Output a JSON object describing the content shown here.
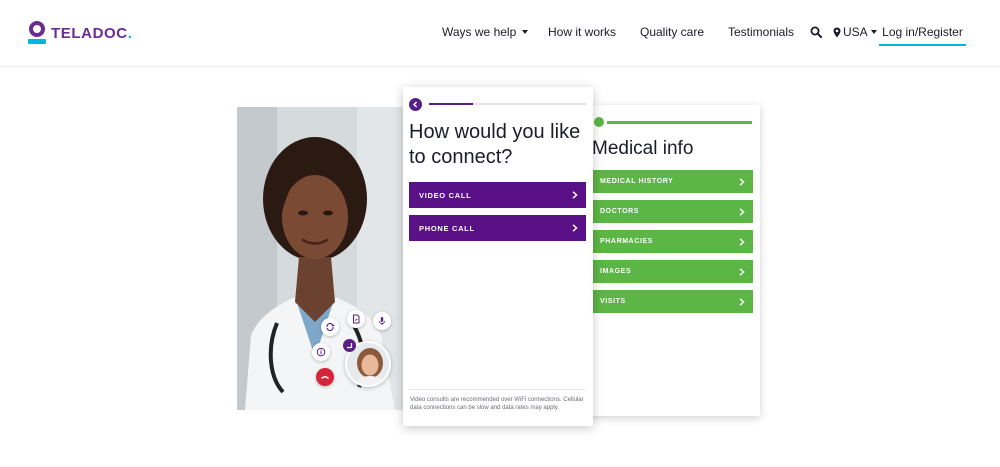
{
  "brand": {
    "name": "TELADOC",
    "dot": ".",
    "colors": {
      "purple": "#6a2c91",
      "cyan": "#00b5e2",
      "green": "#5cb645",
      "button_purple": "#5a1087"
    }
  },
  "nav": {
    "items": [
      {
        "label": "Ways we help",
        "has_dropdown": true
      },
      {
        "label": "How it works"
      },
      {
        "label": "Quality care"
      },
      {
        "label": "Testimonials"
      }
    ],
    "search_icon": "search-icon",
    "country": "USA",
    "login": "Log in/Register"
  },
  "connect_card": {
    "title": "How would you like to connect?",
    "progress": 0.28,
    "options": [
      "VIDEO CALL",
      "PHONE CALL"
    ],
    "note": "Video consults are recommended over WiFi connections. Cellular data connections can be slow and data rates may apply."
  },
  "medical_card": {
    "title": "Medical info",
    "items": [
      "MEDICAL HISTORY",
      "DOCTORS",
      "PHARMACIES",
      "IMAGES",
      "VISITS"
    ]
  },
  "video_call": {
    "controls": [
      "switch-camera-icon",
      "document-icon",
      "microphone-icon",
      "info-icon",
      "end-call-icon"
    ]
  }
}
